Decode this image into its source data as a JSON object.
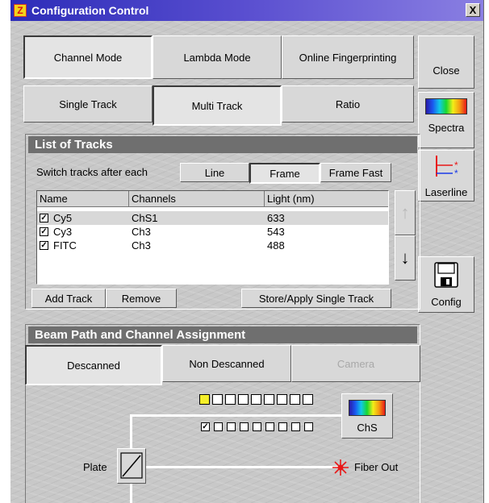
{
  "window": {
    "title": "Configuration Control",
    "close_label": "X",
    "app_icon_glyph": "Z"
  },
  "mode_tabs": {
    "channel": "Channel Mode",
    "lambda": "Lambda Mode",
    "online": "Online Fingerprinting"
  },
  "track_tabs": {
    "single": "Single Track",
    "multi": "Multi Track",
    "ratio": "Ratio"
  },
  "side": {
    "close": "Close",
    "spectra": "Spectra",
    "laserline": "Laserline",
    "config": "Config"
  },
  "tracks": {
    "header": "List of Tracks",
    "switch_label": "Switch tracks after each",
    "switch_line": "Line",
    "switch_frame": "Frame",
    "switch_frame_fast": "Frame Fast",
    "columns": [
      "Name",
      "Channels",
      "Light (nm)"
    ],
    "rows": [
      {
        "checked": true,
        "name": "Cy5",
        "channels": "ChS1",
        "light": "633"
      },
      {
        "checked": true,
        "name": "Cy3",
        "channels": "Ch3",
        "light": "543"
      },
      {
        "checked": true,
        "name": "FITC",
        "channels": "Ch3",
        "light": "488"
      }
    ],
    "up_arrow": "↑",
    "down_arrow": "↓",
    "add": "Add Track",
    "remove": "Remove",
    "store": "Store/Apply Single Track"
  },
  "beam": {
    "header": "Beam Path and Channel Assignment",
    "descanned": "Descanned",
    "non_descanned": "Non Descanned",
    "camera": "Camera",
    "chs_label": "ChS",
    "plate_label": "Plate",
    "fiber_out_label": "Fiber Out",
    "check_glyph": "✓"
  },
  "colors": {
    "title_gradient_start": "#2c2cb8",
    "group_header": "#6f6f6f",
    "laser_red": "#e81818",
    "channel_yellow": "#f5ef2a"
  }
}
